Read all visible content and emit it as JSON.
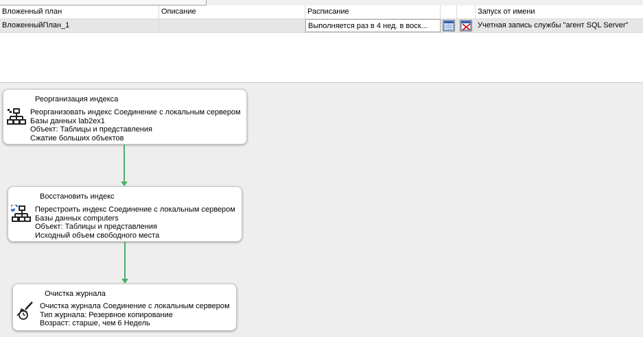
{
  "grid": {
    "headers": {
      "plan": "Вложенный план",
      "description": "Описание",
      "schedule": "Расписание",
      "run_as": "Запуск от имени"
    },
    "row": {
      "plan": "ВложенныйПлан_1",
      "description": "",
      "schedule": "Выполняется раз в 4 нед. в воск...",
      "run_as": "Учетная запись службы \"агент SQL Server\""
    }
  },
  "tasks": [
    {
      "title": "Реорганизация индекса",
      "icon": "hierarchy-icon",
      "lines": [
        "Реорганизовать индекс Соединение с локальным сервером",
        "Базы данных lab2ex1",
        "Объект: Таблицы и представления",
        "Сжатие больших объектов"
      ]
    },
    {
      "title": "Восстановить индекс",
      "icon": "rebuild-hierarchy-icon",
      "lines": [
        "Перестроить индекс Соединение с локальным сервером",
        "Базы данных computers",
        "Объект: Таблицы и представления",
        "Исходный объем свободного места"
      ]
    },
    {
      "title": "Очистка журнала",
      "icon": "broom-clock-icon",
      "lines": [
        "Очистка журнала Соединение с локальным сервером",
        "Тип журнала: Резервное копирование",
        "Возраст: старше, чем 6 Недель"
      ]
    }
  ],
  "colors": {
    "connector": "#4caf6a",
    "selected_row": "#e6e6e6"
  }
}
